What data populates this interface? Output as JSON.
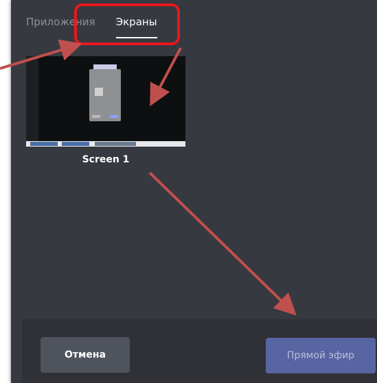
{
  "tabs": [
    {
      "label": "Приложения",
      "active": false
    },
    {
      "label": "Экраны",
      "active": true
    }
  ],
  "screens": [
    {
      "label": "Screen 1"
    }
  ],
  "footer": {
    "cancel_label": "Отмена",
    "live_label": "Прямой эфир"
  },
  "colors": {
    "background": "#36393f",
    "footer": "#2f3136",
    "annotation_box": "#e8181f",
    "annotation_arrow": "#c0504d",
    "live_button": "#5865a3",
    "cancel_button": "#4f545c"
  },
  "icons": [
    "annotation-arrow"
  ]
}
